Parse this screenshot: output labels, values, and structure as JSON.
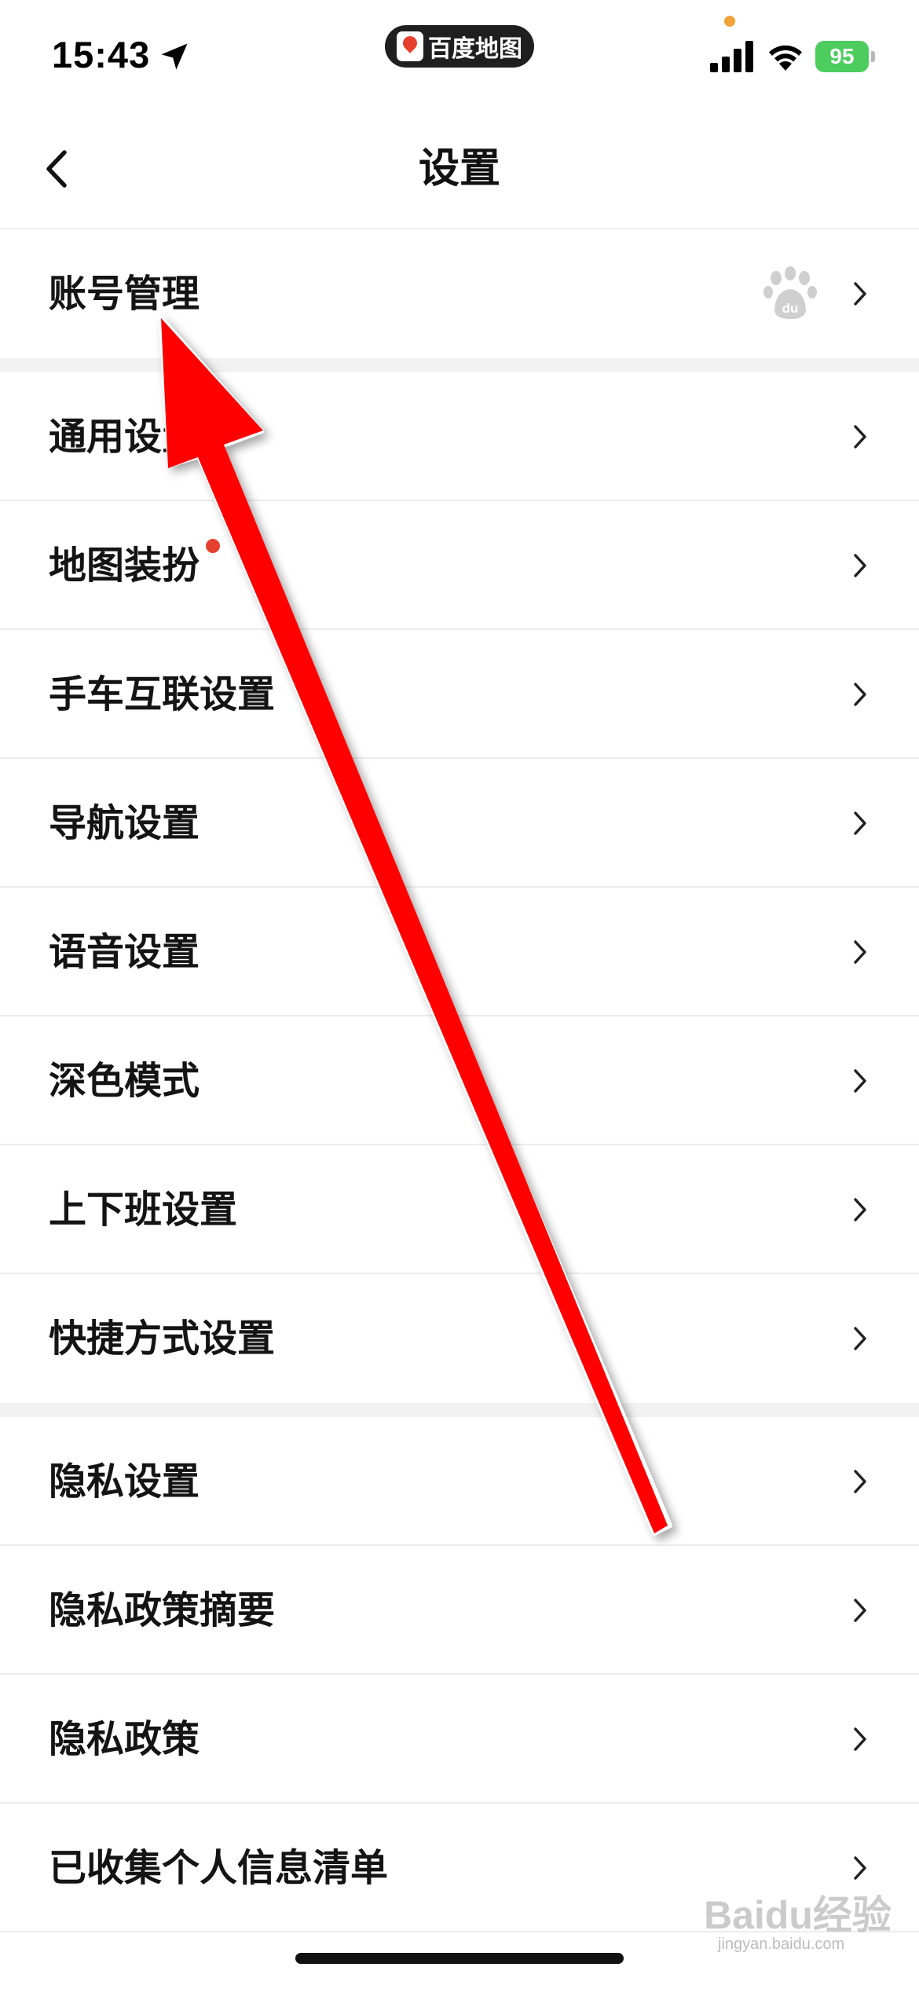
{
  "status_bar": {
    "time": "15:43",
    "app_pill_label": "百度地图",
    "battery": "95"
  },
  "nav": {
    "title": "设置"
  },
  "groups": [
    {
      "items": [
        {
          "label": "账号管理",
          "icon": "baidu-paw-icon"
        }
      ]
    },
    {
      "items": [
        {
          "label": "通用设置"
        },
        {
          "label": "地图装扮",
          "badge": "red-dot"
        },
        {
          "label": "手车互联设置"
        },
        {
          "label": "导航设置"
        },
        {
          "label": "语音设置"
        },
        {
          "label": "深色模式"
        },
        {
          "label": "上下班设置"
        },
        {
          "label": "快捷方式设置"
        }
      ]
    },
    {
      "items": [
        {
          "label": "隐私设置"
        },
        {
          "label": "隐私政策摘要"
        },
        {
          "label": "隐私政策"
        },
        {
          "label": "已收集个人信息清单"
        }
      ]
    }
  ],
  "watermark": {
    "main": "Baidu经验",
    "sub": "jingyan.baidu.com"
  },
  "colors": {
    "accent_red": "#e8402f",
    "arrow_red": "#ff0000",
    "battery_green": "#4ccd5e"
  }
}
